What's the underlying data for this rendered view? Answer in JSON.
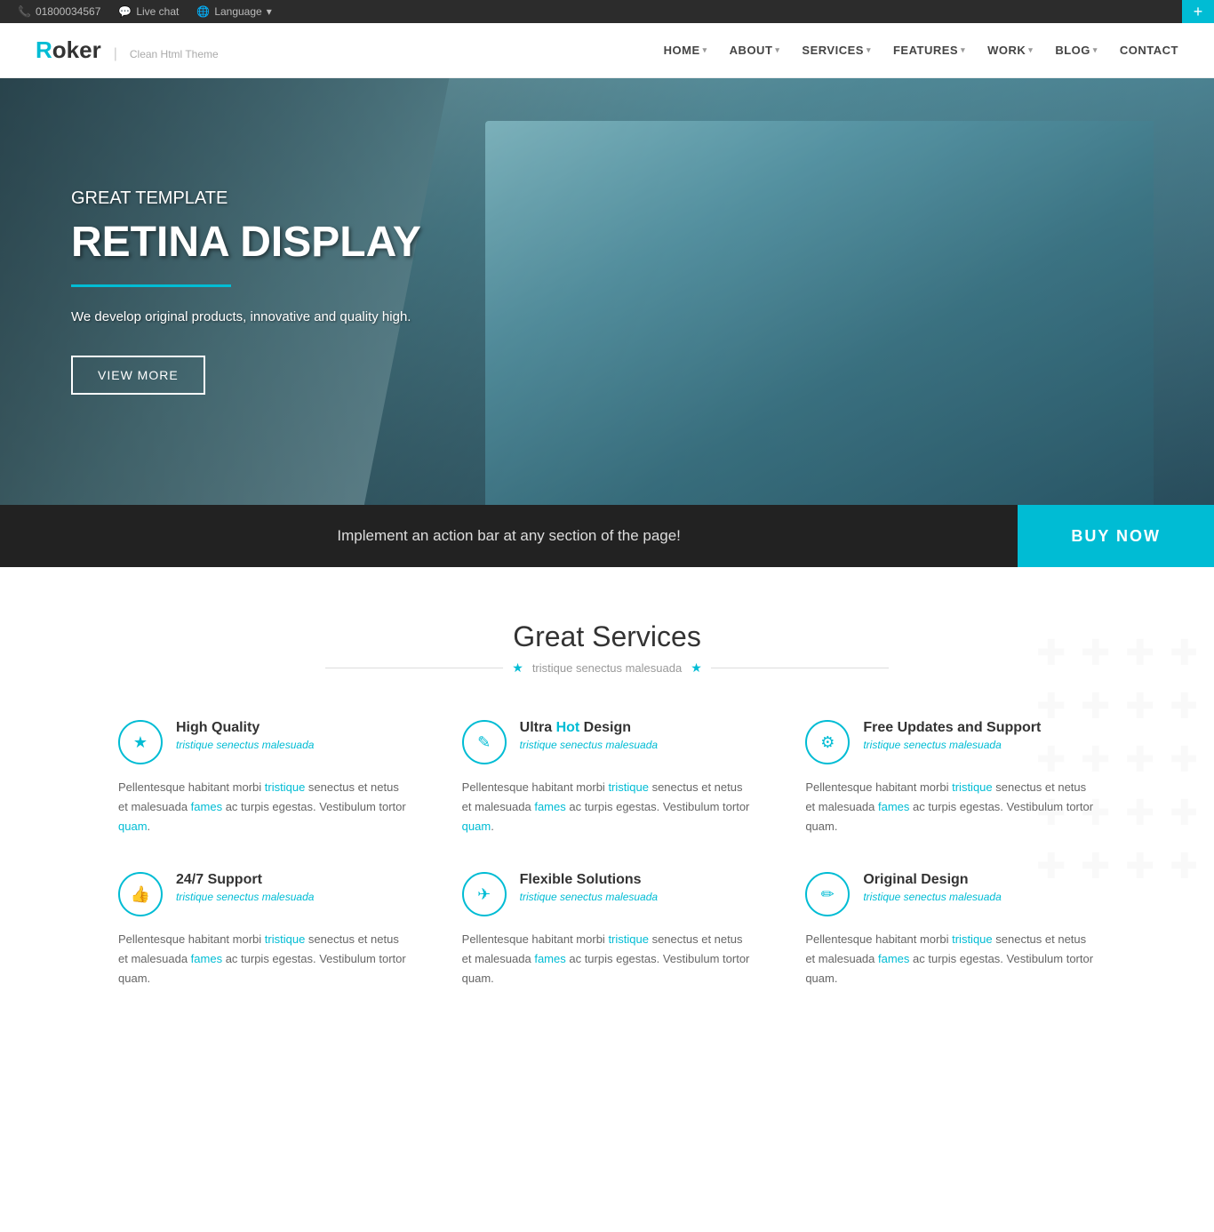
{
  "topbar": {
    "phone": "01800034567",
    "chat": "Live chat",
    "language": "Language",
    "plus": "+"
  },
  "logo": {
    "r": "R",
    "rest": "oker",
    "divider": "|",
    "subtitle": "Clean Html Theme"
  },
  "nav": {
    "items": [
      {
        "label": "HOME",
        "has_arrow": true
      },
      {
        "label": "ABOUT",
        "has_arrow": true
      },
      {
        "label": "SERVICES",
        "has_arrow": true
      },
      {
        "label": "FEATURES",
        "has_arrow": true
      },
      {
        "label": "WORK",
        "has_arrow": true
      },
      {
        "label": "BLOG",
        "has_arrow": true
      },
      {
        "label": "CONTACT",
        "has_arrow": false
      }
    ]
  },
  "hero": {
    "subtitle": "GREAT TEMPLATE",
    "title": "RETINA DISPLAY",
    "description": "We develop original products, innovative and quality high.",
    "button": "View More"
  },
  "actionbar": {
    "text": "Implement an action bar at any section of the page!",
    "button": "BUY NOW"
  },
  "services": {
    "title": "Great Services",
    "subtitle": "tristique senectus malesuada",
    "items": [
      {
        "icon": "★",
        "title": "High Quality",
        "subtitle": "tristique senectus malesuada",
        "description": "Pellentesque habitant morbi tristique senectus et netus et malesuada fames ac turpis egestas. Vestibulum tortor quam.",
        "link_word": "tristique"
      },
      {
        "icon": "✎",
        "title_start": "Ultra ",
        "title_hot": "Hot",
        "title_end": " Design",
        "subtitle": "tristique senectus malesuada",
        "description": "Pellentesque habitant morbi tristique senectus et netus et malesuada fames ac turpis egestas. Vestibulum tortor quam.",
        "link_word": "tristique",
        "link_word2": "fames"
      },
      {
        "icon": "⚙",
        "title": "Free Updates and Support",
        "subtitle": "tristique senectus malesuada",
        "description": "Pellentesque habitant morbi tristique senectus et netus et malesuada fames ac turpis egestas. Vestibulum tortor quam.",
        "link_word": "tristique"
      },
      {
        "icon": "👍",
        "title": "24/7 Support",
        "subtitle": "tristique senectus malesuada",
        "description": "Pellentesque habitant morbi tristique senectus et netus et malesuada fames ac turpis egestas. Vestibulum tortor quam.",
        "link_word": "tristique"
      },
      {
        "icon": "✈",
        "title": "Flexible Solutions",
        "subtitle": "tristique senectus malesuada",
        "description": "Pellentesque habitant morbi tristique senectus et netus et malesuada fames ac turpis egestas. Vestibulum tortor quam.",
        "link_word": "tristique"
      },
      {
        "icon": "✏",
        "title": "Original Design",
        "subtitle": "tristique senectus malesuada",
        "description": "Pellentesque habitant morbi tristique senectus et netus et malesuada fames ac turpis egestas. Vestibulum tortor quam.",
        "link_word": "tristique"
      }
    ]
  },
  "colors": {
    "accent": "#00bcd4",
    "dark": "#222222",
    "text": "#666666"
  }
}
